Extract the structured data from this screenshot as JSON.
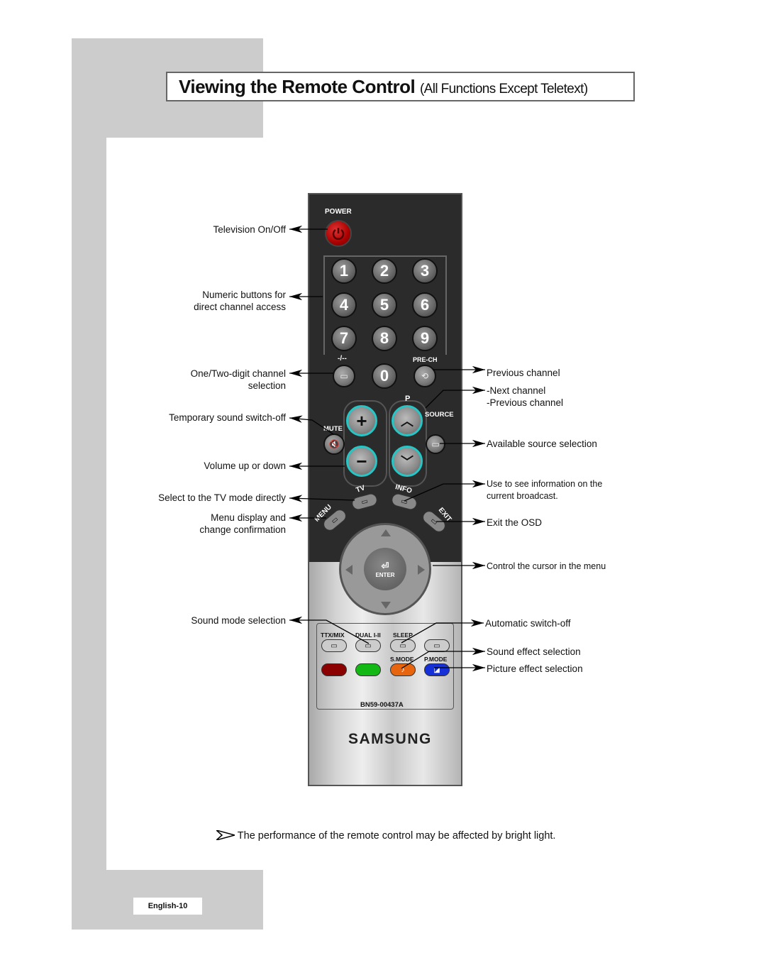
{
  "page": {
    "title_main": "Viewing the Remote Control",
    "title_sub": "(All Functions Except Teletext)",
    "note": "The performance of the remote control may be affected by bright light.",
    "page_number": "English-10"
  },
  "labels_left": [
    {
      "id": "power",
      "lines": [
        "Television On/Off"
      ]
    },
    {
      "id": "numeric",
      "lines": [
        "Numeric buttons for",
        "direct channel access"
      ]
    },
    {
      "id": "digit",
      "lines": [
        "One/Two-digit channel",
        "selection"
      ]
    },
    {
      "id": "mute",
      "lines": [
        "Temporary sound switch-off"
      ]
    },
    {
      "id": "volume",
      "lines": [
        "Volume up or down"
      ]
    },
    {
      "id": "tv",
      "lines": [
        "Select to the TV mode directly"
      ]
    },
    {
      "id": "menu",
      "lines": [
        "Menu display and",
        "change confirmation"
      ]
    },
    {
      "id": "smode",
      "lines": [
        "Sound mode selection"
      ]
    }
  ],
  "labels_right": [
    {
      "id": "prech",
      "lines": [
        "Previous channel"
      ]
    },
    {
      "id": "channel",
      "lines": [
        "-Next channel",
        "-Previous channel"
      ]
    },
    {
      "id": "source",
      "lines": [
        "Available source selection"
      ]
    },
    {
      "id": "info",
      "lines": [
        "Use to see information on the",
        "current broadcast."
      ]
    },
    {
      "id": "exit",
      "lines": [
        "Exit the OSD"
      ]
    },
    {
      "id": "cursor",
      "lines": [
        "Control the cursor in the menu"
      ]
    },
    {
      "id": "sleep",
      "lines": [
        "Automatic switch-off"
      ]
    },
    {
      "id": "sound_effect",
      "lines": [
        "Sound effect selection"
      ]
    },
    {
      "id": "picture_effect",
      "lines": [
        "Picture effect selection"
      ]
    }
  ],
  "remote": {
    "power_label": "POWER",
    "digits": [
      "1",
      "2",
      "3",
      "4",
      "5",
      "6",
      "7",
      "8",
      "9",
      "0"
    ],
    "digit_toggle_label": "-/--",
    "prech_label": "PRE-CH",
    "channel_label": "P",
    "source_label": "SOURCE",
    "mute_label": "MUTE",
    "vol_up": "+",
    "vol_down": "−",
    "tv_label": "TV",
    "info_label": "INFO",
    "menu_label": "MENU",
    "exit_label": "EXIT",
    "enter_label": "ENTER",
    "ttx_label": "TTX/MIX",
    "dual_label": "DUAL I-II",
    "sleep_label": "SLEEP",
    "smode_label": "S.MODE",
    "pmode_label": "P.MODE",
    "model": "BN59-00437A",
    "brand": "SAMSUNG",
    "colors": {
      "red": "#8b0000",
      "green": "#14b814",
      "orange": "#e8650f",
      "blue": "#1530d8",
      "accent_ring": "#27c6c6"
    }
  }
}
